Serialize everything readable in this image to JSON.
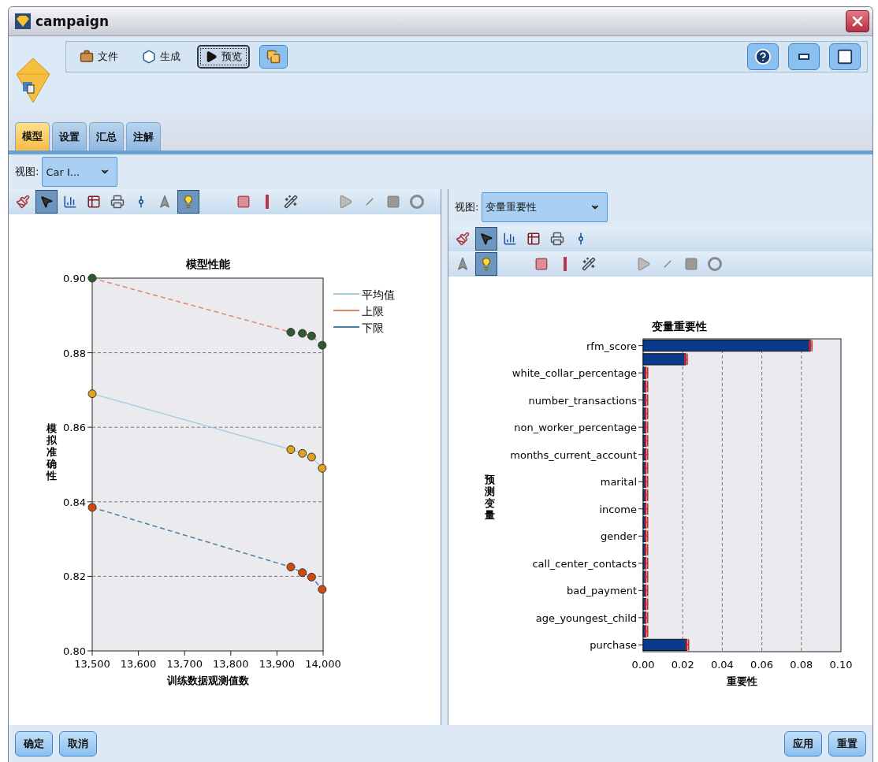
{
  "window": {
    "title": "campaign"
  },
  "toolbar": {
    "buttons": [
      {
        "kind": "menu",
        "label": "文件",
        "selected": false
      },
      {
        "kind": "menu",
        "label": "生成",
        "selected": false
      },
      {
        "kind": "preview",
        "label": "预览",
        "selected": true
      },
      {
        "kind": "icon",
        "selected": false
      }
    ]
  },
  "tabs": [
    {
      "label": "模型",
      "selected": true
    },
    {
      "label": "设置",
      "selected": false
    },
    {
      "label": "汇总",
      "selected": false
    },
    {
      "label": "注解",
      "selected": false
    }
  ],
  "left_panel": {
    "view_label": "视图:",
    "view_value": "Car I...",
    "tools": [
      {
        "selected": false
      },
      {
        "selected": true
      },
      {
        "selected": false
      },
      {
        "selected": false
      },
      {
        "selected": false
      },
      {
        "selected": false
      },
      {
        "selected": false
      },
      {
        "selected": true
      },
      {
        "selected": false
      },
      {
        "selected": false
      },
      {
        "selected": false
      },
      {
        "selected": false
      },
      {
        "selected": false
      },
      {
        "selected": false
      },
      {
        "selected": false
      }
    ],
    "chart_data": {
      "type": "line",
      "title": "模型性能",
      "xlabel": "训练数据观测值数",
      "ylabel": "模拟准确性",
      "x": [
        13500,
        13930,
        13955,
        13975,
        13998
      ],
      "xlim": [
        13500,
        14000
      ],
      "ylim": [
        0.8,
        0.9
      ],
      "xticks": [
        {
          "value": 13500,
          "label": "13,500"
        },
        {
          "value": 13600,
          "label": "13,600"
        },
        {
          "value": 13700,
          "label": "13,700"
        },
        {
          "value": 13800,
          "label": "13,800"
        },
        {
          "value": 13900,
          "label": "13,900"
        },
        {
          "value": 14000,
          "label": "14,000"
        }
      ],
      "yticks": [
        {
          "value": 0.8,
          "label": "0.80"
        },
        {
          "value": 0.82,
          "label": "0.82"
        },
        {
          "value": 0.84,
          "label": "0.84"
        },
        {
          "value": 0.86,
          "label": "0.86"
        },
        {
          "value": 0.88,
          "label": "0.88"
        },
        {
          "value": 0.9,
          "label": "0.90"
        }
      ],
      "series": [
        {
          "name": "平均值",
          "color": "#a8cfe0",
          "line_style": "solid",
          "marker": "circle",
          "values": [
            0.869,
            0.854,
            0.853,
            0.852,
            0.849
          ]
        },
        {
          "name": "上限",
          "color": "#d98a6a",
          "line_style": "dashed",
          "marker": "circle",
          "values": [
            0.9,
            0.8855,
            0.8852,
            0.8845,
            0.882
          ]
        },
        {
          "name": "下限",
          "color": "#4a7fa0",
          "line_style": "dashed",
          "marker": "circle",
          "values": [
            0.8385,
            0.8225,
            0.821,
            0.8198,
            0.8165
          ]
        }
      ],
      "grid": true,
      "legend": true
    }
  },
  "right_panel": {
    "view_label": "视图:",
    "view_value": "变量重要性",
    "tools_row_1": [
      {
        "selected": false
      },
      {
        "selected": true
      },
      {
        "selected": false
      },
      {
        "selected": false
      },
      {
        "selected": false
      },
      {
        "selected": false
      }
    ],
    "tools_row_2": [
      {
        "selected": false
      },
      {
        "selected": true
      },
      {
        "selected": false
      },
      {
        "selected": false
      },
      {
        "selected": false
      },
      {
        "selected": false
      },
      {
        "selected": false
      },
      {
        "selected": false
      },
      {
        "selected": false
      }
    ],
    "chart_data": {
      "type": "bar",
      "orientation": "horizontal",
      "title": "变量重要性",
      "xlabel": "重要性",
      "ylabel": "预测变量",
      "categories": [
        "rfm_score",
        null,
        "white_collar_percentage",
        null,
        "number_transactions",
        null,
        "non_worker_percentage",
        null,
        "months_current_account",
        null,
        "marital",
        null,
        "income",
        null,
        "gender",
        null,
        "call_center_contacts",
        null,
        "bad_payment",
        null,
        "age_youngest_child",
        null,
        "purchase"
      ],
      "xlim": [
        0,
        0.1
      ],
      "xticks": [
        {
          "value": 0,
          "label": "0.00"
        },
        {
          "value": 0.02,
          "label": "0.02"
        },
        {
          "value": 0.04,
          "label": "0.04"
        },
        {
          "value": 0.06,
          "label": "0.06"
        },
        {
          "value": 0.08,
          "label": "0.08"
        },
        {
          "value": 0.1,
          "label": "0.10"
        }
      ],
      "grid": true,
      "series": [
        {
          "color": "#0a3a8c",
          "values": [
            0.0845,
            0.0215,
            0.0015,
            0.0015,
            0.0015,
            0.0015,
            0.0015,
            0.0015,
            0.0015,
            0.0015,
            0.0015,
            0.0015,
            0.0015,
            0.0015,
            0.0015,
            0.0015,
            0.0015,
            0.0015,
            0.0015,
            0.0015,
            0.0015,
            0.0015,
            0.0222
          ]
        }
      ]
    }
  },
  "footer": {
    "left_buttons": [
      "确定",
      "取消"
    ],
    "right_buttons": [
      "应用",
      "重置"
    ]
  }
}
